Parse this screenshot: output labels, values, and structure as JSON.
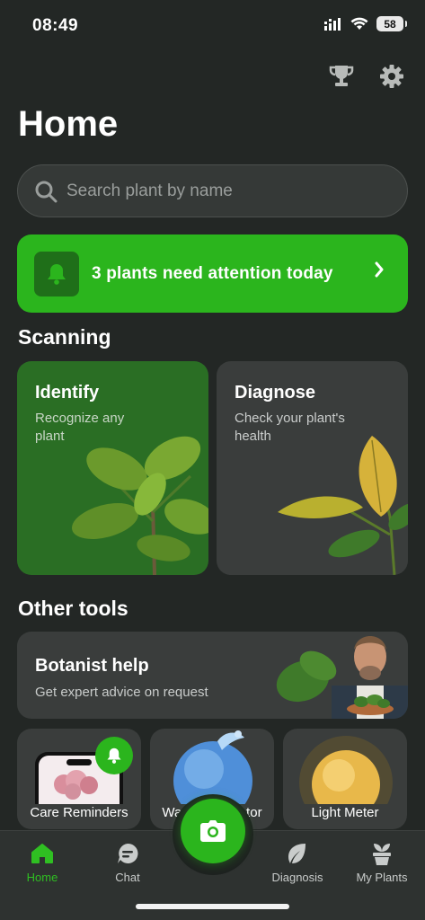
{
  "status_bar": {
    "time": "08:49",
    "battery": "58"
  },
  "header": {
    "title": "Home",
    "trophy_icon": "trophy-icon",
    "settings_icon": "gear-icon"
  },
  "search": {
    "placeholder": "Search plant by name",
    "value": ""
  },
  "attention": {
    "text": "3 plants need attention today"
  },
  "scanning": {
    "title": "Scanning",
    "identify": {
      "title": "Identify",
      "subtitle": "Recognize any plant"
    },
    "diagnose": {
      "title": "Diagnose",
      "subtitle": "Check your plant's health"
    }
  },
  "other_tools": {
    "title": "Other tools",
    "botanist": {
      "title": "Botanist help",
      "subtitle": "Get expert advice on request"
    },
    "tiles": [
      {
        "label": "Care Reminders"
      },
      {
        "label": "Water Calculator"
      },
      {
        "label": "Light Meter"
      }
    ]
  },
  "tabbar": {
    "items": [
      {
        "label": "Home",
        "icon": "home-icon"
      },
      {
        "label": "Chat",
        "icon": "chat-icon"
      },
      {
        "label": "Diagnosis",
        "icon": "leaf-icon"
      },
      {
        "label": "My Plants",
        "icon": "plant-pot-icon"
      }
    ]
  },
  "colors": {
    "accent": "#2bb51d",
    "background": "#232725",
    "card": "#3a3d3c",
    "identify_card": "#2a6e24"
  }
}
